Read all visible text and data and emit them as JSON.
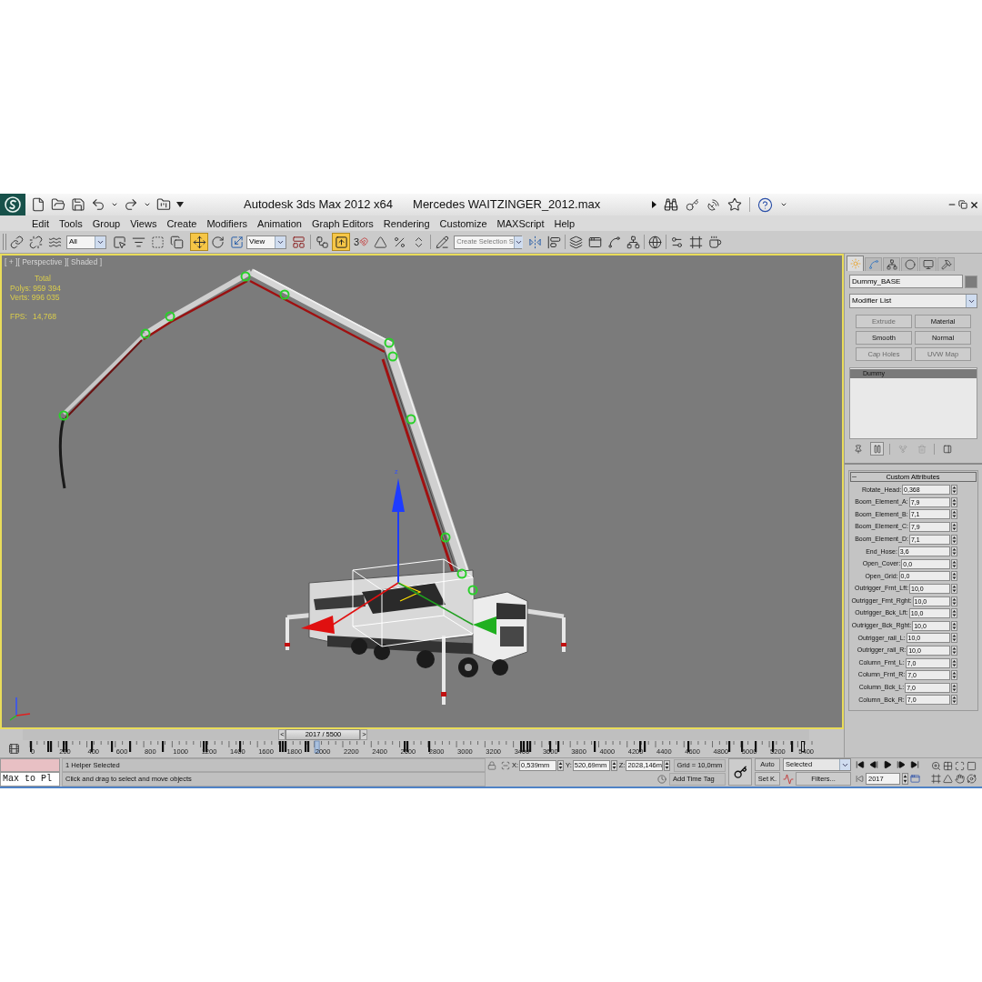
{
  "title_bar": {
    "app_title": "Autodesk 3ds Max  2012 x64",
    "document_title": "Mercedes  WAITZINGER_2012.max"
  },
  "menu": [
    "Edit",
    "Tools",
    "Group",
    "Views",
    "Create",
    "Modifiers",
    "Animation",
    "Graph Editors",
    "Rendering",
    "Customize",
    "MAXScript",
    "Help"
  ],
  "toolbar": {
    "selection_filter": "All",
    "reference_coordinate_system": "View",
    "snaps_toggle": "3",
    "named_selection": {
      "placeholder": "Create Selection S"
    },
    "move_tool_selected": true,
    "keyboard_override_on": true
  },
  "viewport": {
    "active": true,
    "label_menus": [
      "[ + ]",
      "[ Perspective ]",
      "[ Shaded ]"
    ],
    "stats_title": "Total",
    "stats": [
      {
        "label": "Polys:",
        "value": "959 394"
      },
      {
        "label": "Verts:",
        "value": "996 035"
      }
    ],
    "fps": {
      "label": "FPS:",
      "value": "14,768"
    },
    "gizmo_axis_label": "z"
  },
  "command_panel": {
    "tabs": [
      {
        "selected": true
      },
      {
        "selected": false
      },
      {
        "selected": false
      },
      {
        "selected": false
      },
      {
        "selected": false
      },
      {
        "selected": false
      }
    ],
    "object_name": "Dummy_BASE",
    "modifier_list": "Modifier List",
    "modifier_buttons": [
      {
        "label": "Extrude",
        "disabled": true
      },
      {
        "label": "Material",
        "disabled": false
      },
      {
        "label": "Smooth",
        "disabled": false
      },
      {
        "label": "Normal",
        "disabled": false
      },
      {
        "label": "Cap Holes",
        "disabled": true
      },
      {
        "label": "UVW Map",
        "disabled": true
      }
    ],
    "stack": [
      {
        "label": "Dummy",
        "selected": true
      }
    ],
    "stack_tools": [
      {
        "on": false,
        "disabled": false
      },
      {
        "on": true,
        "disabled": false
      },
      {
        "on": false,
        "disabled": true
      },
      {
        "on": false,
        "disabled": true
      },
      {
        "on": false,
        "disabled": false
      }
    ],
    "rollout": {
      "title": "Custom Attributes",
      "expanded": true,
      "params": [
        {
          "label": "Rotate_Head:",
          "value": "0,368"
        },
        {
          "label": "Boom_Element_A:",
          "value": "7,9"
        },
        {
          "label": "Boom_Element_B:",
          "value": "7,1"
        },
        {
          "label": "Boom_Element_C:",
          "value": "7,9"
        },
        {
          "label": "Boom_Element_D:",
          "value": "7,1"
        },
        {
          "label": "End_Hose:",
          "value": "3,6"
        },
        {
          "label": "Open_Cover:",
          "value": "0,0"
        },
        {
          "label": "Open_Grid:",
          "value": "0,0"
        },
        {
          "label": "Outrigger_Frnt_Lft:",
          "value": "10,0"
        },
        {
          "label": "Outrigger_Frnt_Rght:",
          "value": "10,0"
        },
        {
          "label": "Outrigger_Bck_Lft:",
          "value": "10,0"
        },
        {
          "label": "Outrigger_Bck_Rght:",
          "value": "10,0"
        },
        {
          "label": "Outrigger_rail_L:",
          "value": "10,0"
        },
        {
          "label": "Outrigger_rail_R:",
          "value": "10,0"
        },
        {
          "label": "Column_Frnt_L:",
          "value": "7,0"
        },
        {
          "label": "Column_Frnt_R:",
          "value": "7,0"
        },
        {
          "label": "Column_Bck_L:",
          "value": "7,0"
        },
        {
          "label": "Column_Bck_R:",
          "value": "7,0"
        }
      ]
    }
  },
  "time_slider": {
    "prev": "<",
    "label": "2017 / 5500",
    "next": ">",
    "level": 0.367
  },
  "track_bar": {
    "ticks": [
      "0",
      "200",
      "400",
      "600",
      "800",
      "1000",
      "1200",
      "1400",
      "1600",
      "1800",
      "2000",
      "2200",
      "2400",
      "2600",
      "2800",
      "3000",
      "3200",
      "3400",
      "3600",
      "3800",
      "4000",
      "4200",
      "4400",
      "4600",
      "4800",
      "5000",
      "5200",
      "5400"
    ]
  },
  "status": {
    "listener_input": "Max to Pl",
    "selection_info": "1 Helper Selected",
    "prompt": "Click and drag to select and move objects",
    "coordinates": [
      {
        "axis": "X:",
        "value": "0,539mm"
      },
      {
        "axis": "Y:",
        "value": "520,69mm"
      },
      {
        "axis": "Z:",
        "value": "2028,146m"
      }
    ],
    "grid": "Grid = 10,0mm",
    "add_time_tag": "Add Time Tag"
  },
  "animation_controls": {
    "auto_key": "Auto",
    "set_key": "Set K.",
    "key_mode": "Selected",
    "filters": "Filters...",
    "current_frame": "2017"
  }
}
